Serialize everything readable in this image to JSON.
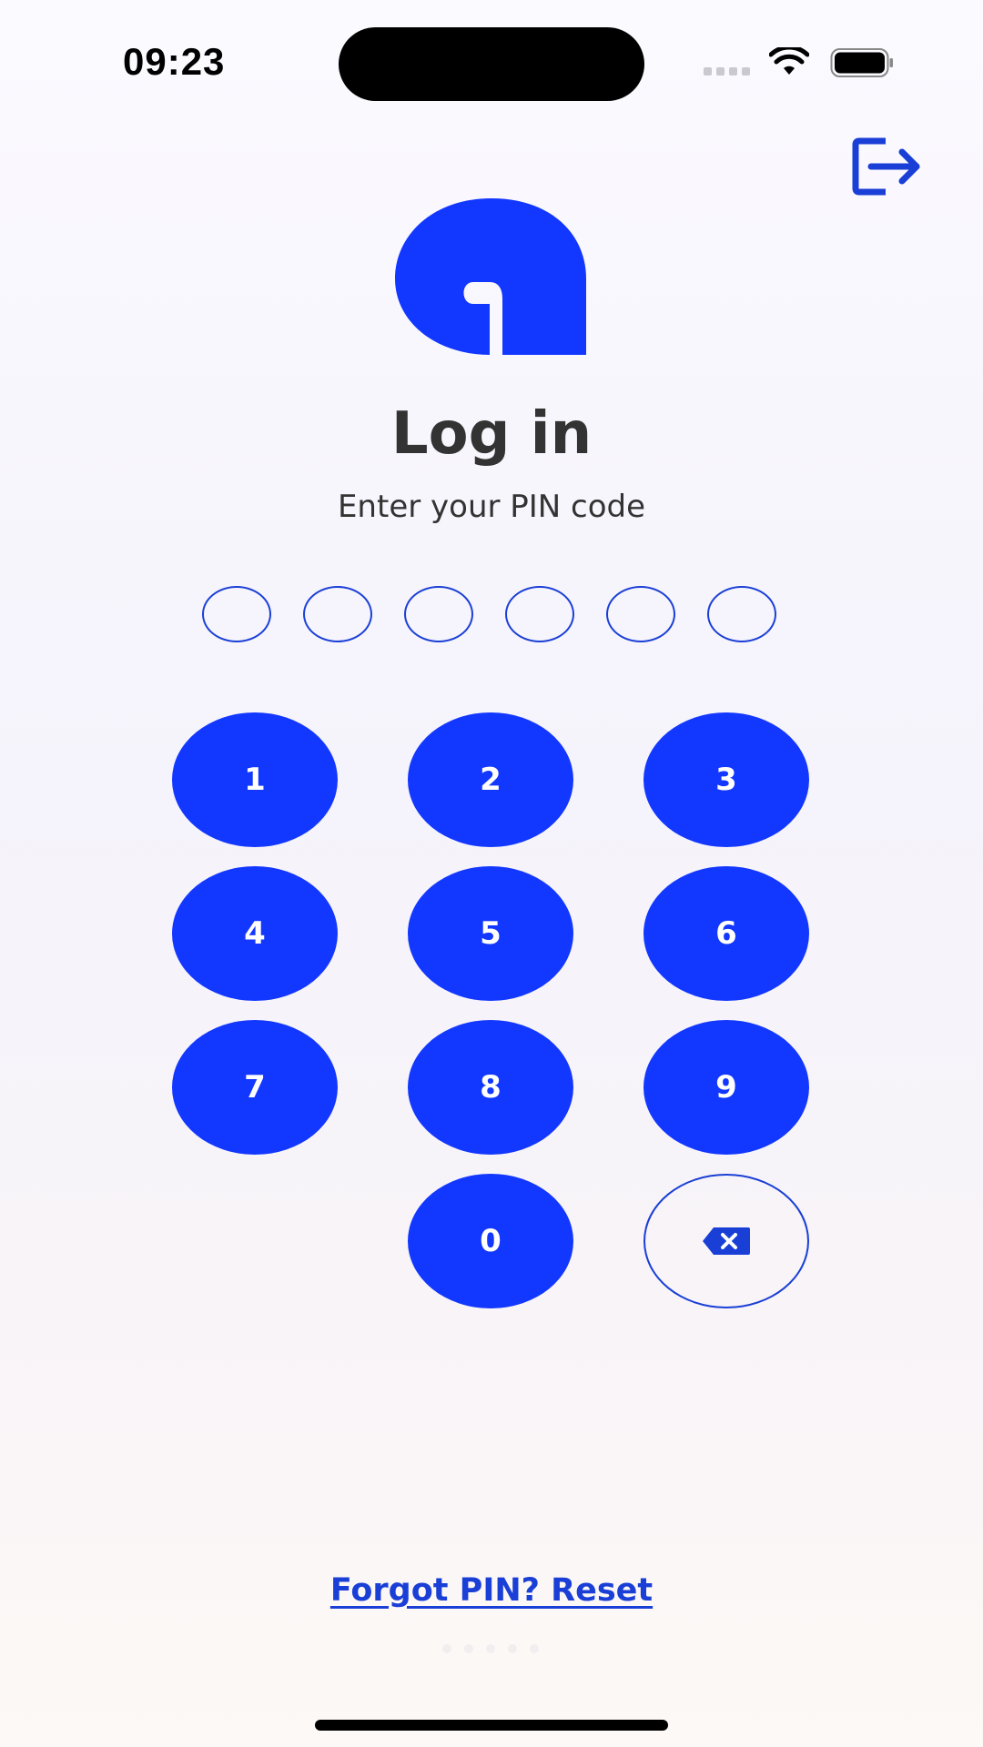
{
  "status_bar": {
    "time": "09:23",
    "icons": [
      "cellular-signal-icon",
      "wifi-icon",
      "battery-icon"
    ]
  },
  "header": {
    "logout_icon": "logout-icon"
  },
  "brand": {
    "logo_icon": "app-logo",
    "accent_color": "#1237ff"
  },
  "login": {
    "title": "Log in",
    "subtitle": "Enter your PIN code",
    "pin_length": 6,
    "pin_entered": 0
  },
  "keypad": {
    "keys": [
      "1",
      "2",
      "3",
      "4",
      "5",
      "6",
      "7",
      "8",
      "9",
      "0"
    ],
    "backspace_icon": "backspace-icon"
  },
  "footer": {
    "forgot_link": "Forgot PIN? Reset"
  }
}
